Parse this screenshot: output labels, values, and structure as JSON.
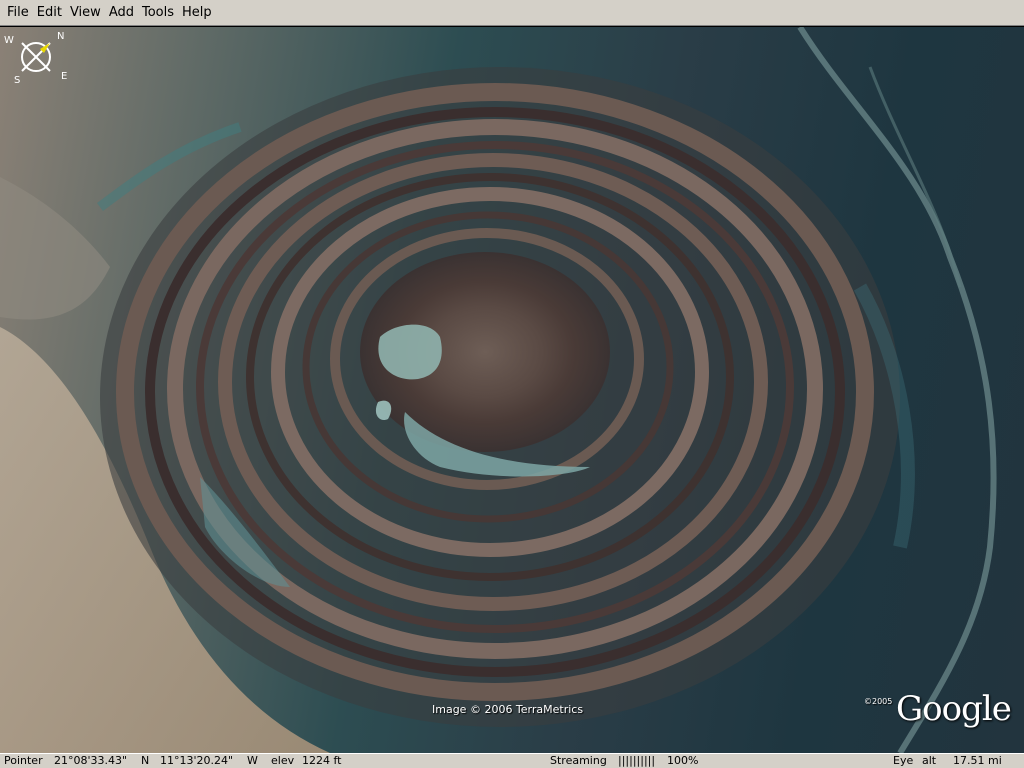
{
  "menu": {
    "items": [
      "File",
      "Edit",
      "View",
      "Add",
      "Tools",
      "Help"
    ]
  },
  "map": {
    "attribution": "Image © 2006 TerraMetrics",
    "copyright_year": "©2005",
    "logo_text": "Google",
    "compass_letters": {
      "n": "N",
      "e": "E",
      "s": "S",
      "w": "W"
    }
  },
  "status": {
    "pointer_label": "Pointer",
    "latitude": "21°08'33.43\"",
    "lat_hemisphere": "N",
    "longitude": "11°13'20.24\"",
    "lon_hemisphere": "W",
    "elev_label": "elev",
    "elev_value": "1224 ft",
    "streaming_label": "Streaming",
    "streaming_bar": "||||||||||",
    "streaming_percent": "100%",
    "eye_label": "Eye",
    "alt_label": "alt",
    "alt_value": "17.51 mi"
  }
}
